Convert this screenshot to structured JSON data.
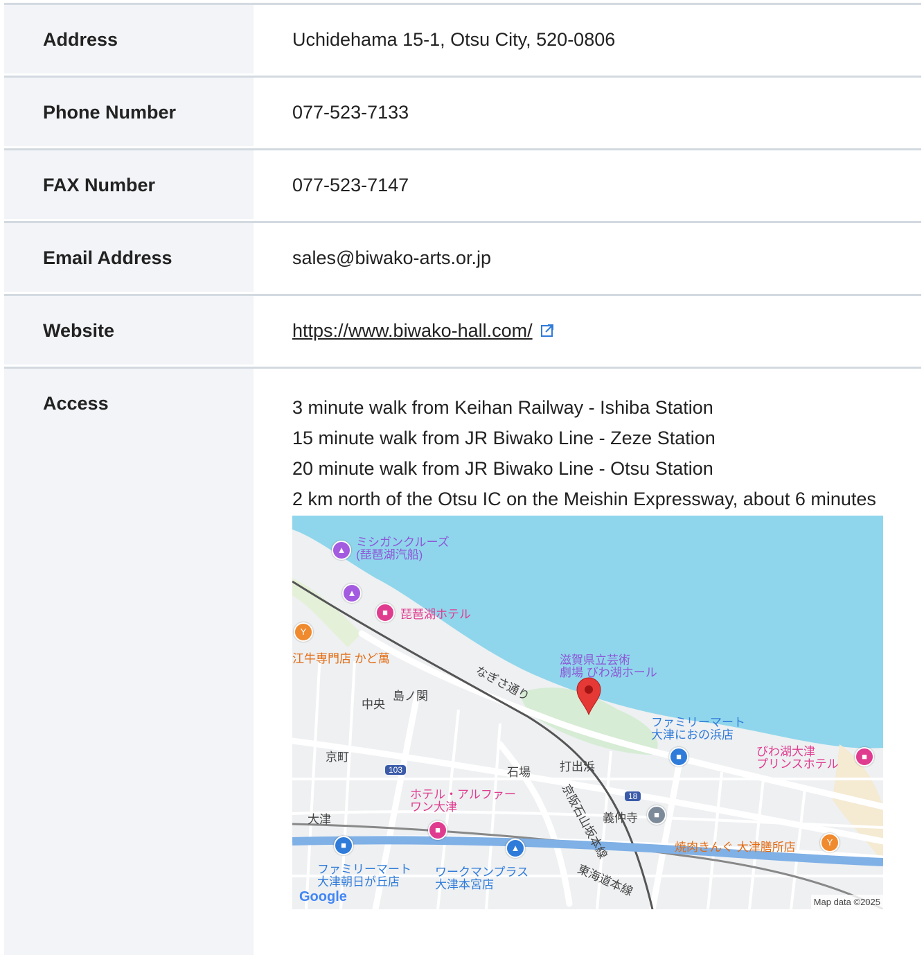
{
  "rows": [
    {
      "label": "Address",
      "value": "Uchidehama 15-1, Otsu City, 520-0806"
    },
    {
      "label": "Phone Number",
      "value": "077-523-7133"
    },
    {
      "label": "FAX Number",
      "value": "077-523-7147"
    },
    {
      "label": "Email Address",
      "value": "sales@biwako-arts.or.jp"
    },
    {
      "label": "Website",
      "value": "https://www.biwako-hall.com/"
    }
  ],
  "access": {
    "label": "Access",
    "lines": [
      "3 minute walk from Keihan Railway - Ishiba Station",
      "15 minute walk from JR Biwako Line - Zeze Station",
      "20 minute walk from JR Biwako Line - Otsu Station",
      "2 km north of the Otsu IC on the Meishin Expressway, about 6 minutes"
    ]
  },
  "map": {
    "labels": {
      "michigan": "ミシガンクルーズ\n(琵琶湖汽船)",
      "biwako_hotel": "琵琶湖ホテル",
      "kadoman": "江牛専門店 かど萬",
      "nagisa": "なぎさ通り",
      "hall": "滋賀県立芸術\n劇場 びわ湖ホール",
      "chuo": "中央",
      "shimanoseki": "島ノ関",
      "familymart_nionohama": "ファミリーマート\n大津におの浜店",
      "prince": "びわ湖大津\nプリンスホテル",
      "kyomachi": "京町",
      "ishiba": "石場",
      "uchidehama": "打出浜",
      "route103": "103",
      "route18": "18",
      "alpha": "ホテル・アルファー\nワン大津",
      "keihan_line": "京阪石山坂本線",
      "otsu": "大津",
      "gichuji": "義仲寺",
      "yakiniku": "焼肉きんぐ 大津膳所店",
      "familymart_asahi": "ファミリーマート\n大津朝日が丘店",
      "workman": "ワークマンプラス\n大津本宮店",
      "tokaido": "東海道本線",
      "google": "Google",
      "map_data": "Map data ©2025"
    }
  },
  "colors": {
    "water": "#8fd6ec",
    "land": "#eef0f2",
    "park": "#d6ecd4",
    "road": "#ffffff",
    "pin": "#e53935"
  }
}
